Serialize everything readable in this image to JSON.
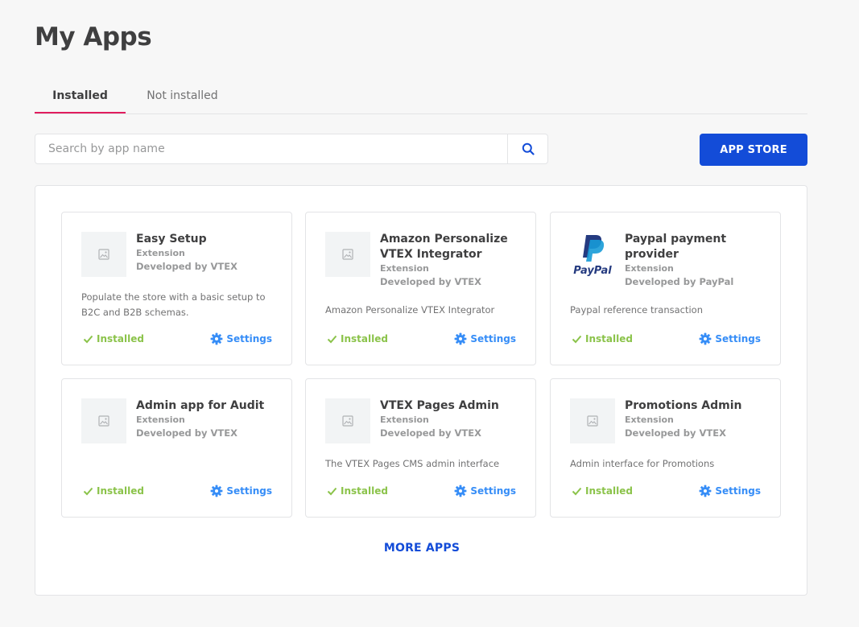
{
  "header": {
    "title": "My Apps"
  },
  "tabs": [
    {
      "label": "Installed",
      "active": true
    },
    {
      "label": "Not installed",
      "active": false
    }
  ],
  "search": {
    "placeholder": "Search by app name",
    "value": ""
  },
  "app_store_button": "APP STORE",
  "apps": [
    {
      "name": "Easy Setup",
      "type": "Extension",
      "developer": "Developed by VTEX",
      "description": "Populate the store with a basic setup to B2C and B2B schemas.",
      "status": "Installed",
      "settings": "Settings",
      "icon": "image-placeholder-icon"
    },
    {
      "name": "Amazon Personalize VTEX Integrator",
      "type": "Extension",
      "developer": "Developed by VTEX",
      "description": "Amazon Personalize VTEX Integrator",
      "status": "Installed",
      "settings": "Settings",
      "icon": "image-placeholder-icon"
    },
    {
      "name": "Paypal payment provider",
      "type": "Extension",
      "developer": "Developed by PayPal",
      "description": "Paypal reference transaction",
      "status": "Installed",
      "settings": "Settings",
      "icon": "paypal-logo",
      "logo_text": "PayPal"
    },
    {
      "name": "Admin app for Audit",
      "type": "Extension",
      "developer": "Developed by VTEX",
      "description": "",
      "status": "Installed",
      "settings": "Settings",
      "icon": "image-placeholder-icon"
    },
    {
      "name": "VTEX Pages Admin",
      "type": "Extension",
      "developer": "Developed by VTEX",
      "description": "The VTEX Pages CMS admin interface",
      "status": "Installed",
      "settings": "Settings",
      "icon": "image-placeholder-icon"
    },
    {
      "name": "Promotions Admin",
      "type": "Extension",
      "developer": "Developed by VTEX",
      "description": "Admin interface for Promotions",
      "status": "Installed",
      "settings": "Settings",
      "icon": "image-placeholder-icon"
    }
  ],
  "more_apps": "MORE APPS",
  "colors": {
    "primary": "#134cd8",
    "active_tab": "#e11d5e",
    "installed": "#8bc34a",
    "settings": "#368df7"
  }
}
